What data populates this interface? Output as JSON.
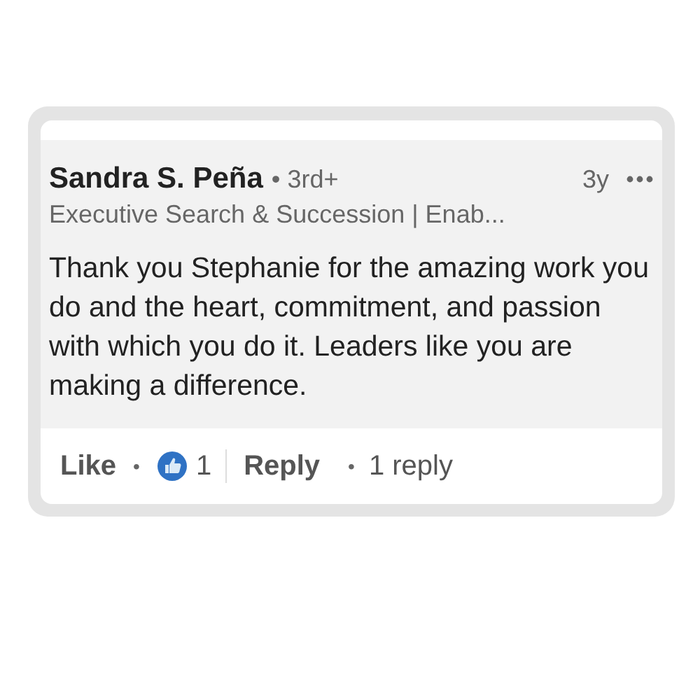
{
  "comment": {
    "author": "Sandra S. Peña",
    "degree": "• 3rd+",
    "time": "3y",
    "headline": "Executive Search & Succession | Enab...",
    "body": "Thank you Stephanie for the amazing work you do and the heart, commitment, and passion with which you do it. Leaders like you are making a difference."
  },
  "actions": {
    "like": "Like",
    "separator_1": "•",
    "reaction_count": "1",
    "reply": "Reply",
    "separator_2": "•",
    "replies": "1 reply"
  }
}
